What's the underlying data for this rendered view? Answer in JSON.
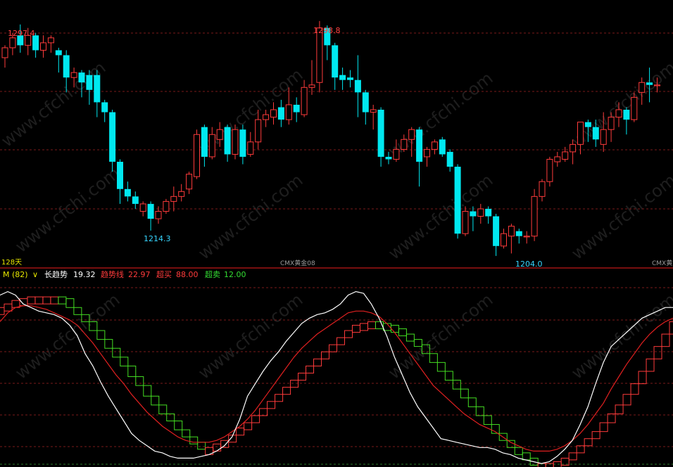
{
  "colors": {
    "background": "#000000",
    "up": "#ff3b3b",
    "down": "#00e8f0",
    "grid": "#7a1a1a",
    "divider": "#c01818",
    "white_line": "#ffffff",
    "red_line": "#e02020",
    "green_steps": "#44dd22",
    "high_label": "#ff4040",
    "low_label": "#37d6ff",
    "watermark": "#1e1e1e"
  },
  "watermark_text": "www.cfchi.com",
  "chart_data": [
    {
      "type": "candlestick",
      "series": [
        {
          "name": "CMX黄金08",
          "candles": [
            [
              1284,
              1288,
              1280,
              1289
            ],
            [
              1288,
              1292,
              1285,
              1294
            ],
            [
              1293,
              1289,
              1286,
              1297.4
            ],
            [
              1289,
              1293,
              1285,
              1296
            ],
            [
              1293,
              1287,
              1284,
              1294
            ],
            [
              1287,
              1290,
              1284,
              1293
            ],
            [
              1290,
              1292,
              1286,
              1293
            ],
            [
              1287,
              1285,
              1278,
              1288
            ],
            [
              1285,
              1276,
              1270,
              1287
            ],
            [
              1276,
              1278,
              1272,
              1280
            ],
            [
              1278,
              1274,
              1268,
              1279
            ],
            [
              1277,
              1271,
              1265,
              1279
            ],
            [
              1277,
              1266,
              1260,
              1279
            ],
            [
              1266,
              1262,
              1258,
              1267
            ],
            [
              1262,
              1242,
              1238,
              1263
            ],
            [
              1242,
              1231,
              1225,
              1243
            ],
            [
              1231,
              1228,
              1226,
              1234
            ],
            [
              1228,
              1225,
              1223,
              1230
            ],
            [
              1222,
              1225,
              1220,
              1226
            ],
            [
              1225,
              1219,
              1214.2,
              1226
            ],
            [
              1219,
              1222,
              1217,
              1224
            ],
            [
              1222,
              1226,
              1221,
              1227
            ],
            [
              1226,
              1228,
              1222,
              1232
            ],
            [
              1228,
              1230,
              1226,
              1233
            ],
            [
              1231,
              1237,
              1229,
              1238
            ],
            [
              1236,
              1253,
              1235,
              1255
            ],
            [
              1256,
              1244,
              1240,
              1257
            ],
            [
              1244,
              1253,
              1243,
              1256
            ],
            [
              1251,
              1255,
              1248,
              1258
            ],
            [
              1256,
              1245,
              1242,
              1257
            ],
            [
              1245,
              1255,
              1243,
              1257
            ],
            [
              1255,
              1244,
              1241,
              1257
            ],
            [
              1245,
              1250,
              1244,
              1254
            ],
            [
              1250,
              1259,
              1247,
              1263
            ],
            [
              1259,
              1261,
              1256,
              1263
            ],
            [
              1260,
              1263,
              1257,
              1266
            ],
            [
              1264,
              1259,
              1256,
              1267
            ],
            [
              1259,
              1265,
              1257,
              1272
            ],
            [
              1265,
              1262,
              1258,
              1268
            ],
            [
              1261,
              1272,
              1260,
              1275
            ],
            [
              1272,
              1273,
              1269,
              1283
            ],
            [
              1274,
              1296,
              1270,
              1298.8
            ],
            [
              1296,
              1289,
              1283,
              1297
            ],
            [
              1289,
              1276,
              1271,
              1290
            ],
            [
              1277,
              1275,
              1271,
              1280
            ],
            [
              1276,
              1275,
              1272,
              1279
            ],
            [
              1275,
              1270,
              1260,
              1285
            ],
            [
              1270,
              1262,
              1257,
              1271
            ],
            [
              1262,
              1263,
              1255,
              1265
            ],
            [
              1263,
              1244,
              1240,
              1264
            ],
            [
              1244,
              1243,
              1241,
              1246
            ],
            [
              1243,
              1247,
              1242,
              1251
            ],
            [
              1247,
              1251,
              1246,
              1253
            ],
            [
              1251,
              1255,
              1244,
              1256
            ],
            [
              1255,
              1242,
              1232,
              1256
            ],
            [
              1244,
              1247,
              1240,
              1248
            ],
            [
              1247,
              1250,
              1245,
              1251
            ],
            [
              1251,
              1245,
              1244,
              1252
            ],
            [
              1246,
              1240,
              1238,
              1247
            ],
            [
              1240,
              1213,
              1211,
              1241
            ],
            [
              1213,
              1222,
              1212,
              1224
            ],
            [
              1222,
              1220,
              1214,
              1224
            ],
            [
              1220,
              1223,
              1217,
              1225
            ],
            [
              1223,
              1220,
              1217,
              1224
            ],
            [
              1220,
              1208,
              1204,
              1221
            ],
            [
              1208,
              1213,
              1207,
              1215
            ],
            [
              1212,
              1216,
              1205,
              1217
            ],
            [
              1214,
              1212,
              1209,
              1215
            ],
            [
              1212,
              1212,
              1209,
              1214
            ],
            [
              1212,
              1228,
              1210,
              1231
            ],
            [
              1228,
              1234,
              1226,
              1235
            ],
            [
              1234,
              1243,
              1232,
              1244
            ],
            [
              1242,
              1244,
              1240,
              1246
            ],
            [
              1243,
              1246,
              1242,
              1248
            ],
            [
              1246,
              1249,
              1241,
              1251
            ],
            [
              1249,
              1258,
              1245,
              1258
            ],
            [
              1258,
              1256,
              1250,
              1259
            ],
            [
              1256,
              1251,
              1248,
              1259
            ],
            [
              1249,
              1255,
              1246,
              1262
            ],
            [
              1255,
              1260,
              1250,
              1262
            ],
            [
              1260,
              1263,
              1256,
              1266
            ],
            [
              1263,
              1259,
              1253,
              1264
            ],
            [
              1259,
              1268,
              1258,
              1270
            ],
            [
              1270,
              1274,
              1265,
              1276
            ],
            [
              1274,
              1273,
              1266,
              1280
            ],
            [
              1273,
              1273,
              1270,
              1276
            ]
          ]
        }
      ],
      "annotations": {
        "high_left": "1297.4",
        "high_mid": "1298.8",
        "low_left": "1214.3",
        "low_right": "1204.0"
      },
      "footer": {
        "period": "128天",
        "symbol_a": "CMX黄金08",
        "symbol_b": "CMX黄"
      },
      "ylim": [
        1200,
        1305
      ]
    },
    {
      "type": "line",
      "header": {
        "menu": "M (82)",
        "items": [
          {
            "label": "长趋势",
            "value": "19.32",
            "color": "#ffffff"
          },
          {
            "label": "趋势线",
            "value": "22.97",
            "color": "#ff3b3b"
          },
          {
            "label": "超买",
            "value": "88.00",
            "color": "#ff3b3b"
          },
          {
            "label": "超卖",
            "value": "12.00",
            "color": "#33dd33"
          }
        ]
      },
      "ylim": [
        0,
        100
      ],
      "series": [
        {
          "name": "长趋势",
          "values": [
            95,
            97,
            95,
            90,
            88,
            86,
            85,
            84,
            82,
            78,
            72,
            62,
            55,
            46,
            38,
            31,
            24,
            17,
            13,
            10,
            7,
            6,
            4,
            3,
            3,
            3,
            4,
            5,
            7,
            10,
            15,
            25,
            38,
            45,
            52,
            58,
            63,
            69,
            74,
            79,
            82,
            84,
            85,
            87,
            90,
            95,
            97,
            96,
            90,
            82,
            72,
            60,
            50,
            40,
            32,
            26,
            20,
            14,
            13,
            12,
            11,
            10,
            9,
            9,
            8,
            6,
            5,
            3,
            2,
            1,
            0,
            1,
            4,
            8,
            13,
            22,
            32,
            45,
            57,
            66,
            70,
            74,
            78,
            82,
            84,
            86,
            88,
            88
          ]
        },
        {
          "name": "趋势线",
          "values": [
            80,
            85,
            88,
            89,
            89,
            88,
            87,
            85,
            83,
            81,
            78,
            73,
            68,
            62,
            56,
            50,
            45,
            39,
            34,
            29,
            25,
            21,
            18,
            15,
            13,
            12,
            12,
            12,
            13,
            15,
            18,
            21,
            25,
            30,
            36,
            42,
            48,
            54,
            60,
            65,
            69,
            73,
            76,
            79,
            82,
            85,
            86,
            86,
            85,
            83,
            79,
            74,
            68,
            62,
            56,
            50,
            44,
            40,
            36,
            32,
            28,
            25,
            22,
            20,
            18,
            15,
            12,
            10,
            8,
            7,
            7,
            7,
            8,
            10,
            13,
            17,
            22,
            28,
            34,
            42,
            49,
            56,
            62,
            68,
            73,
            77,
            80,
            82
          ]
        },
        {
          "name": "step",
          "values": [
            88,
            90,
            92,
            93,
            94,
            94,
            94,
            94,
            93,
            88,
            84,
            80,
            75,
            70,
            65,
            60,
            55,
            49,
            44,
            38,
            33,
            28,
            24,
            19,
            15,
            12,
            9,
            9,
            11,
            13,
            16,
            20,
            23,
            27,
            31,
            35,
            39,
            43,
            47,
            51,
            55,
            59,
            63,
            67,
            71,
            75,
            78,
            79,
            80,
            79,
            78,
            76,
            73,
            70,
            67,
            62,
            57,
            52,
            47,
            42,
            37,
            32,
            27,
            22,
            17,
            13,
            9,
            6,
            3,
            0,
            0,
            0,
            1,
            3,
            6,
            10,
            14,
            18,
            23,
            28,
            33,
            39,
            45,
            52,
            59,
            66,
            73,
            80
          ]
        }
      ]
    }
  ]
}
